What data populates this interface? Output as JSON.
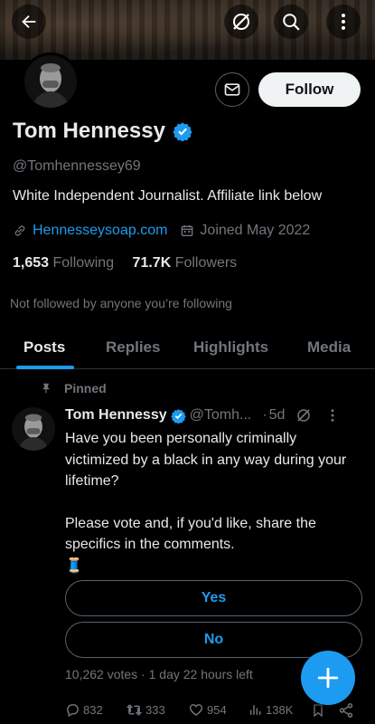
{
  "profile": {
    "name": "Tom Hennessy",
    "handle": "@Tomhennessey69",
    "bio": "White Independent Journalist. Affiliate link below",
    "website": "Hennesseysoap.com",
    "joined": "Joined May 2022",
    "following_count": "1,653",
    "following_label": "Following",
    "followers_count": "71.7K",
    "followers_label": "Followers",
    "not_followed_text": "Not followed by anyone you’re following",
    "follow_label": "Follow"
  },
  "tabs": [
    {
      "label": "Posts"
    },
    {
      "label": "Replies"
    },
    {
      "label": "Highlights"
    },
    {
      "label": "Media"
    }
  ],
  "tweet": {
    "pinned_label": "Pinned",
    "author": "Tom Hennessy",
    "handle": "@Tomh...",
    "dot": "·",
    "time": "5d",
    "text_line1": "Have you been personally criminally victimized by a black in any way during your lifetime?",
    "text_line2": "Please vote and, if you'd like, share the specifics in the comments.",
    "emoji": "🧵",
    "poll_options": [
      {
        "label": "Yes"
      },
      {
        "label": "No"
      }
    ],
    "poll_meta": "10,262 votes · 1 day 22 hours left",
    "replies": "832",
    "retweets": "333",
    "likes": "954",
    "views": "138K"
  },
  "colors": {
    "accent": "#1d9bf0",
    "background": "#000000",
    "text": "#e7e9ea",
    "muted": "#71767b"
  },
  "icons": [
    "back-arrow-icon",
    "grok-icon",
    "search-icon",
    "more-icon",
    "message-icon",
    "verified-icon",
    "link-icon",
    "calendar-icon",
    "pin-icon",
    "reply-icon",
    "retweet-icon",
    "like-icon",
    "views-icon",
    "bookmark-icon",
    "share-icon",
    "compose-plus-icon"
  ]
}
